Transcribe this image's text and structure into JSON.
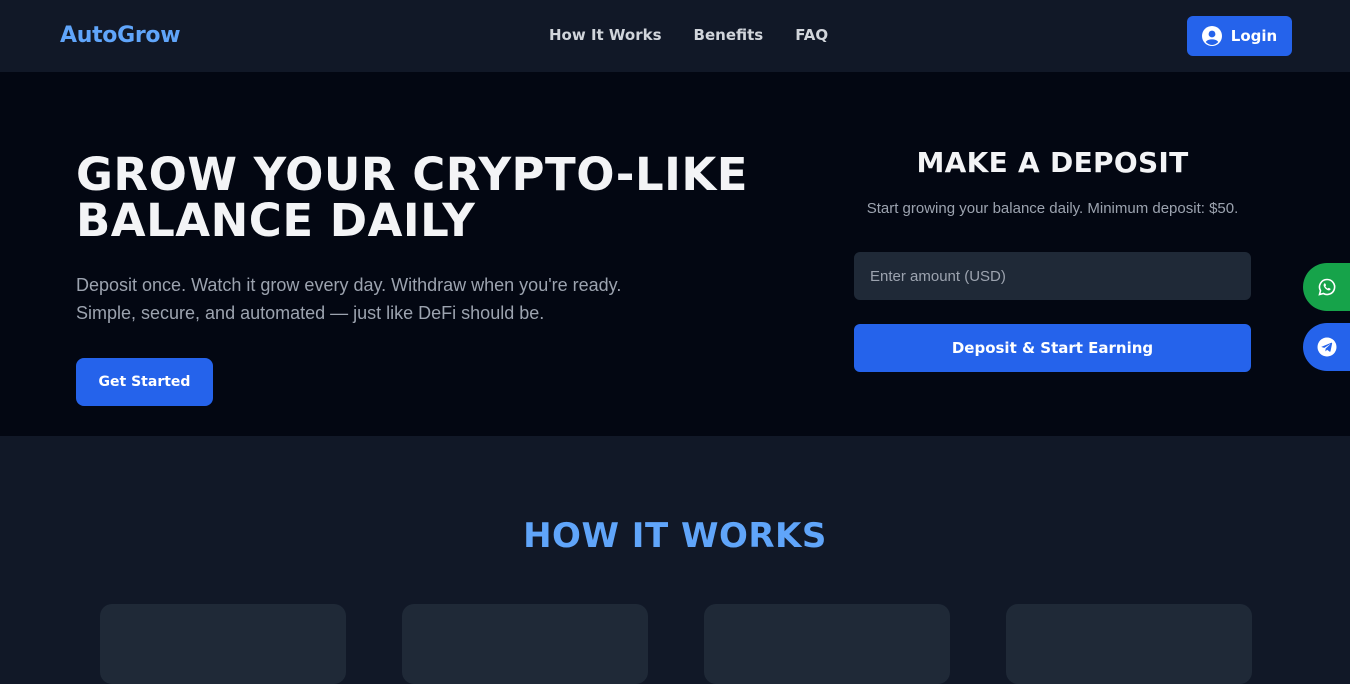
{
  "brand": {
    "name": "AutoGrow",
    "accent": "#60a5fa",
    "primary": "#2563eb"
  },
  "nav": {
    "links": [
      "How It Works",
      "Benefits",
      "FAQ"
    ],
    "login": {
      "label": "Login",
      "icon": "user-circle-icon"
    }
  },
  "hero": {
    "title_line1": "GROW YOUR CRYPTO-LIKE",
    "title_line2": "BALANCE DAILY",
    "subtitle_line1": "Deposit once. Watch it grow every day. Withdraw when you're ready.",
    "subtitle_line2": "Simple, secure, and automated — just like DeFi should be.",
    "cta": "Get Started"
  },
  "deposit": {
    "title": "MAKE A DEPOSIT",
    "subtitle": "Start growing your balance daily. Minimum deposit: $50.",
    "input_placeholder": "Enter amount (USD)",
    "input_value": "",
    "button": "Deposit & Start Earning"
  },
  "floating": [
    {
      "icon": "whatsapp-icon",
      "color": "#16a34a"
    },
    {
      "icon": "telegram-icon",
      "color": "#2563eb"
    }
  ],
  "how_it_works": {
    "title": "HOW IT WORKS",
    "card_count": 4
  }
}
